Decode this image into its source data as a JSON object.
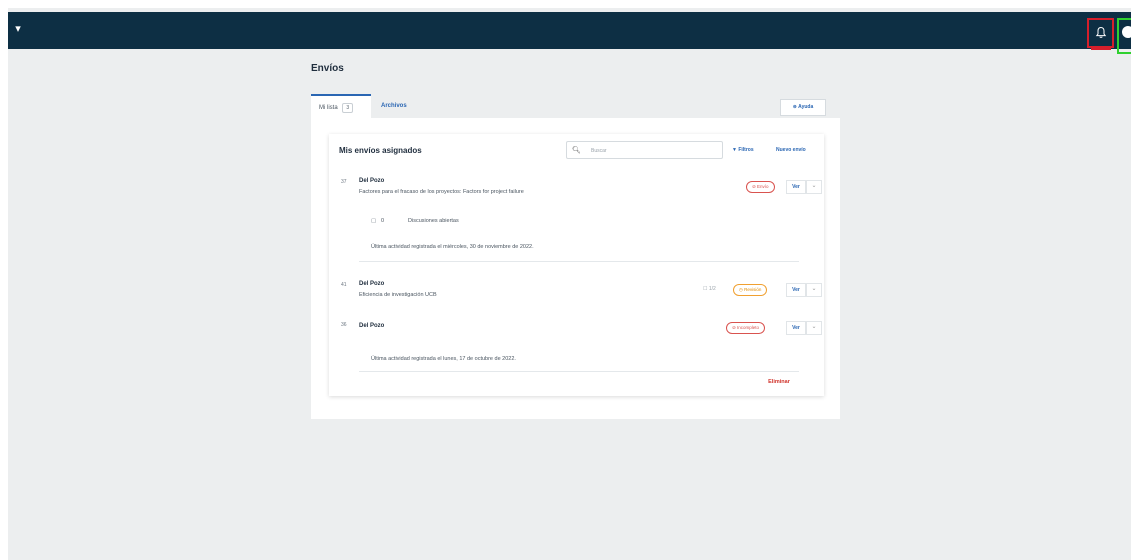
{
  "topbar": {
    "menu_glyph": "▾",
    "icons": [
      "bell-icon",
      "user-avatar-icon"
    ],
    "highlight_colors": {
      "bell": "#d61f2b",
      "avatar": "#2fd12f"
    },
    "bar_color": "#0d2f44"
  },
  "page": {
    "title": "Envíos",
    "tabs": [
      {
        "label": "Mi lista",
        "count": "3",
        "active": true
      },
      {
        "label": "Archivos",
        "active": false
      }
    ],
    "help_label": "⊕ Ayuda"
  },
  "panel": {
    "title": "Mis envíos asignados",
    "search": {
      "placeholder": "Buscar",
      "icon": "search-icon"
    },
    "filters_label": "▼ Filtros",
    "new_label": "Nuevo envío",
    "submissions": [
      {
        "id": "37",
        "author": "Del Pozo",
        "description": "Factores para el fracaso de los proyectos: Factors for project failure",
        "status": "⊘ Envío",
        "view_label": "Ver",
        "more_label": "⌄",
        "discussions": {
          "count": "0",
          "label": "Discusiones abiertas"
        },
        "activity": "Última actividad registrada el miércoles, 30 de noviembre de 2022."
      },
      {
        "id": "41",
        "author": "Del Pozo",
        "description": "Eficiencia de investigación UCB",
        "comments": "☐ 1/2",
        "status": "◷ Revisión",
        "view_label": "Ver",
        "more_label": "⌄"
      },
      {
        "id": "36",
        "author": "Del Pozo",
        "status": "⊘ Incompleto",
        "view_label": "Ver",
        "more_label": "⌄",
        "activity": "Última actividad registrada el lunes, 17 de octubre de 2022.",
        "delete_label": "Eliminar"
      }
    ]
  }
}
